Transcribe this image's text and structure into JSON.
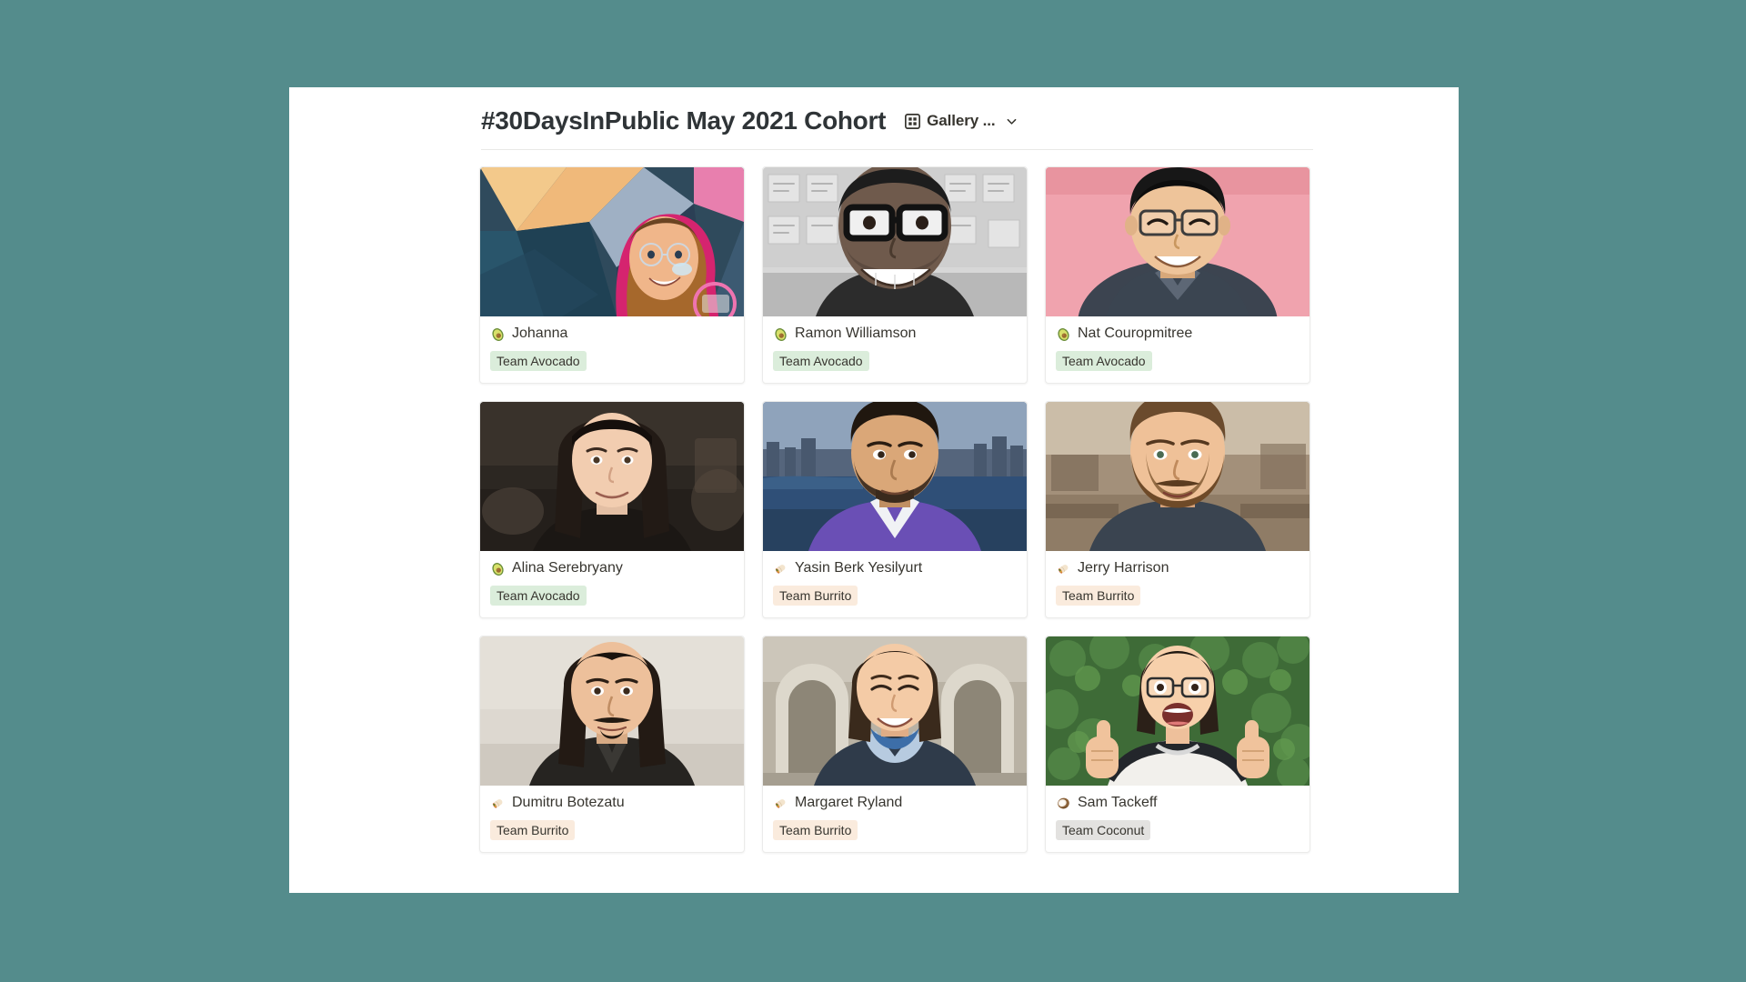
{
  "theme": {
    "background_color": "#548c8c",
    "panel_color": "#ffffff",
    "text_color": "#37352f"
  },
  "header": {
    "title": "#30DaysInPublic May 2021 Cohort",
    "view_label": "Gallery ...",
    "view_icon": "grid-icon",
    "dropdown_icon": "chevron-down-icon"
  },
  "tag_colors": {
    "Team Avocado": "#dbeddb",
    "Team Burrito": "#faebdd",
    "Team Coconut": "#e3e2e0"
  },
  "gallery": {
    "cards": [
      {
        "name": "Johanna",
        "emoji": "avocado",
        "tag": "Team Avocado",
        "tag_style": "green",
        "photo": "portrait-johanna"
      },
      {
        "name": "Ramon Williamson",
        "emoji": "avocado",
        "tag": "Team Avocado",
        "tag_style": "green",
        "photo": "portrait-ramon"
      },
      {
        "name": "Nat Couropmitree",
        "emoji": "avocado",
        "tag": "Team Avocado",
        "tag_style": "green",
        "photo": "portrait-nat"
      },
      {
        "name": "Alina Serebryany",
        "emoji": "avocado",
        "tag": "Team Avocado",
        "tag_style": "green",
        "photo": "portrait-alina"
      },
      {
        "name": "Yasin Berk Yesilyurt",
        "emoji": "burrito",
        "tag": "Team Burrito",
        "tag_style": "orange",
        "photo": "portrait-yasin"
      },
      {
        "name": "Jerry Harrison",
        "emoji": "burrito",
        "tag": "Team Burrito",
        "tag_style": "orange",
        "photo": "portrait-jerry"
      },
      {
        "name": "Dumitru Botezatu",
        "emoji": "burrito",
        "tag": "Team Burrito",
        "tag_style": "orange",
        "photo": "portrait-dumitru"
      },
      {
        "name": "Margaret Ryland",
        "emoji": "burrito",
        "tag": "Team Burrito",
        "tag_style": "orange",
        "photo": "portrait-margaret"
      },
      {
        "name": "Sam Tackeff",
        "emoji": "coconut",
        "tag": "Team Coconut",
        "tag_style": "gray",
        "photo": "portrait-sam"
      }
    ]
  }
}
